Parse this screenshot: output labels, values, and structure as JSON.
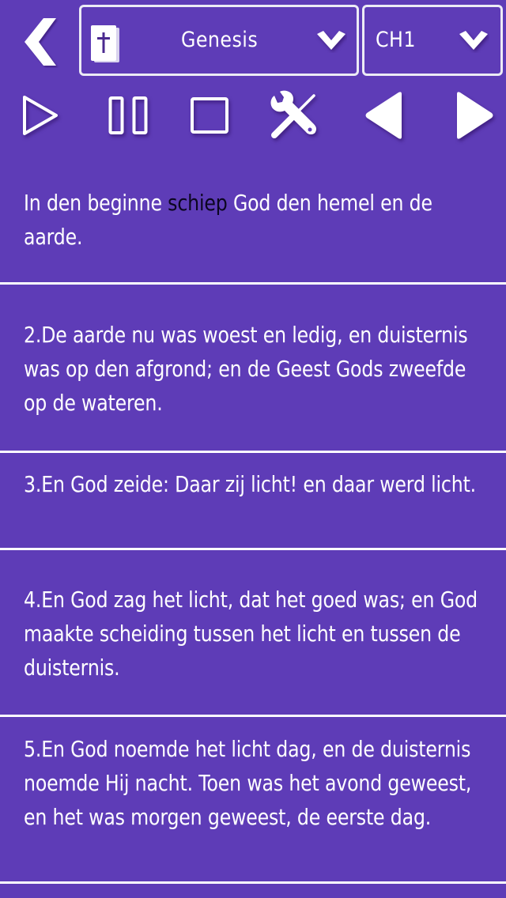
{
  "header": {
    "back_icon": "chevron-left-icon",
    "book_select": {
      "icon": "bible-icon",
      "value": "Genesis",
      "chevron": "chevron-down-icon"
    },
    "chapter_select": {
      "value": "CH1",
      "chevron": "chevron-down-icon"
    }
  },
  "toolbar": {
    "buttons": [
      {
        "name": "play",
        "icon": "play-outline-icon"
      },
      {
        "name": "pause",
        "icon": "pause-outline-icon"
      },
      {
        "name": "stop",
        "icon": "stop-outline-icon"
      },
      {
        "name": "settings",
        "icon": "tools-icon"
      },
      {
        "name": "previous",
        "icon": "triangle-left-icon"
      },
      {
        "name": "next",
        "icon": "triangle-right-icon"
      }
    ]
  },
  "colors": {
    "background": "#5e3cb7",
    "text": "#ffffff",
    "highlight_text": "#0b0620",
    "divider": "#ffffff"
  },
  "verses": [
    {
      "before": "In den beginne ",
      "highlight": "schiep",
      "after": " God den hemel en de aarde."
    },
    {
      "text": "2.De aarde nu was woest en ledig, en duisternis was op den afgrond; en de Geest Gods zweefde op de wateren."
    },
    {
      "text": "3.En God zeide: Daar zij licht! en daar werd licht."
    },
    {
      "text": "4.En God zag het licht, dat het goed was; en God maakte scheiding tussen het licht en tussen de duisternis."
    },
    {
      "text": "5.En God noemde het licht dag, en de duisternis noemde Hij nacht. Toen was het avond geweest, en het was morgen geweest, de eerste dag."
    }
  ]
}
